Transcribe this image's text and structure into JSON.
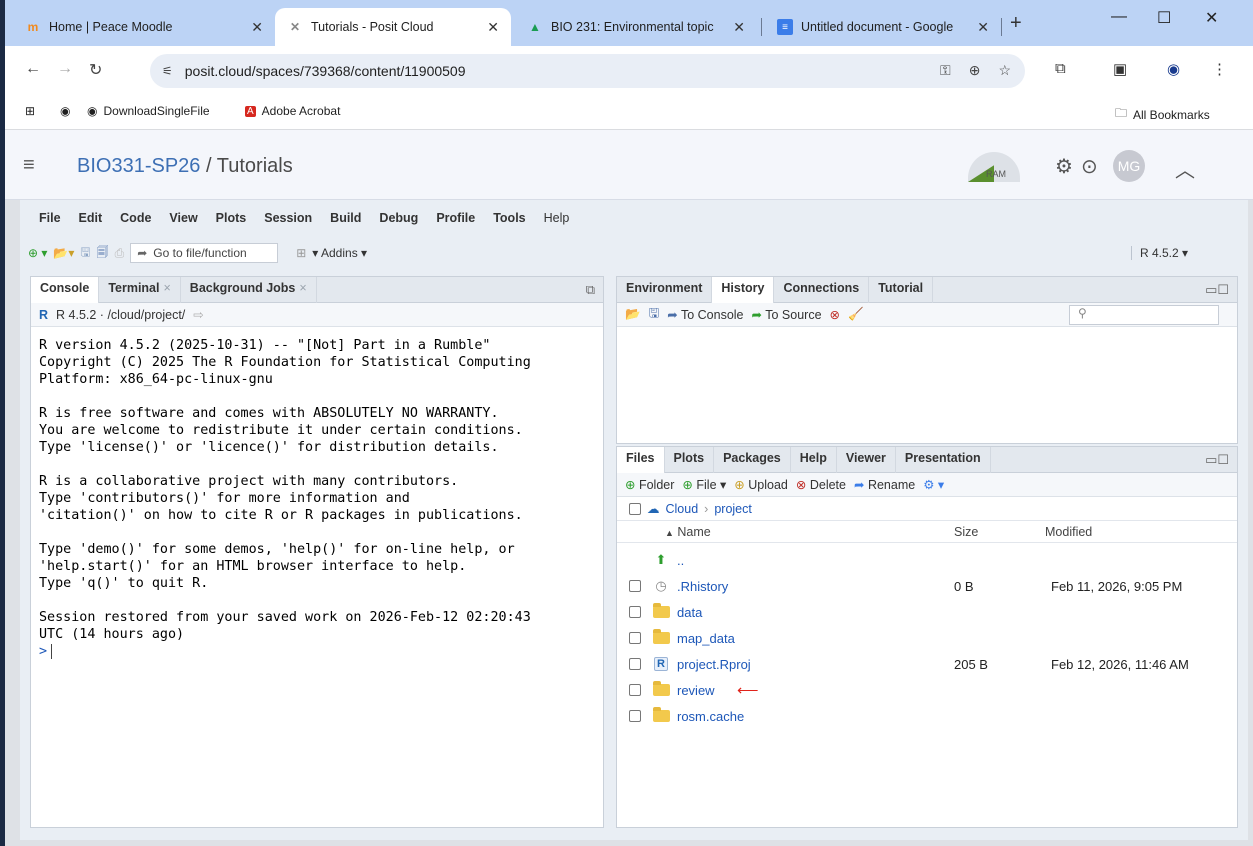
{
  "browser": {
    "tabs": [
      {
        "title": "Home | Peace Moodle",
        "favicon": "moodle-icon"
      },
      {
        "title": "Tutorials - Posit Cloud",
        "favicon": "posit-icon",
        "active": true
      },
      {
        "title": "BIO 231: Environmental topic",
        "favicon": "google-drive-icon"
      },
      {
        "title": "Untitled document - Google",
        "favicon": "google-docs-icon"
      }
    ],
    "url": "posit.cloud/spaces/739368/content/11900509",
    "bookmarks": [
      "DownloadSingleFile",
      "Adobe Acrobat"
    ],
    "all_bookmarks": "All Bookmarks"
  },
  "posit": {
    "space": "BIO331-SP26",
    "separator": "/",
    "project": "Tutorials",
    "ram_label": "RAM",
    "avatar_initials": "MG"
  },
  "rstudio": {
    "menu": [
      "File",
      "Edit",
      "Code",
      "View",
      "Plots",
      "Session",
      "Build",
      "Debug",
      "Profile",
      "Tools",
      "Help"
    ],
    "goto_file": "Go to file/function",
    "addins": "Addins",
    "r_version": "R 4.5.2"
  },
  "console_pane": {
    "tabs": [
      "Console",
      "Terminal",
      "Background Jobs"
    ],
    "path": "R 4.5.2 · /cloud/project/",
    "lines": [
      "R version 4.5.2 (2025-10-31) -- \"[Not] Part in a Rumble\"",
      "Copyright (C) 2025 The R Foundation for Statistical Computing",
      "Platform: x86_64-pc-linux-gnu",
      "",
      "R is free software and comes with ABSOLUTELY NO WARRANTY.",
      "You are welcome to redistribute it under certain conditions.",
      "Type 'license()' or 'licence()' for distribution details.",
      "",
      "R is a collaborative project with many contributors.",
      "Type 'contributors()' for more information and",
      "'citation()' on how to cite R or R packages in publications.",
      "",
      "Type 'demo()' for some demos, 'help()' for on-line help, or",
      "'help.start()' for an HTML browser interface to help.",
      "Type 'q()' to quit R.",
      "",
      "Session restored from your saved work on 2026-Feb-12 02:20:43",
      "UTC (14 hours ago)"
    ],
    "prompt": ">"
  },
  "env_pane": {
    "tabs": [
      "Environment",
      "History",
      "Connections",
      "Tutorial"
    ],
    "to_console": "To Console",
    "to_source": "To Source"
  },
  "files_pane": {
    "tabs": [
      "Files",
      "Plots",
      "Packages",
      "Help",
      "Viewer",
      "Presentation"
    ],
    "toolbar": {
      "folder": "Folder",
      "file": "File",
      "upload": "Upload",
      "delete": "Delete",
      "rename": "Rename"
    },
    "breadcrumb": [
      "Cloud",
      "project"
    ],
    "columns": {
      "name": "Name",
      "size": "Size",
      "modified": "Modified"
    },
    "parent": "..",
    "rows": [
      {
        "name": ".Rhistory",
        "size": "0 B",
        "modified": "Feb 11, 2026, 9:05 PM",
        "icon": "history-file-icon"
      },
      {
        "name": "data",
        "size": "",
        "modified": "",
        "icon": "folder-icon"
      },
      {
        "name": "map_data",
        "size": "",
        "modified": "",
        "icon": "folder-icon"
      },
      {
        "name": "project.Rproj",
        "size": "205 B",
        "modified": "Feb 12, 2026, 11:46 AM",
        "icon": "rproj-icon"
      },
      {
        "name": "review",
        "size": "",
        "modified": "",
        "icon": "folder-icon"
      },
      {
        "name": "rosm.cache",
        "size": "",
        "modified": "",
        "icon": "folder-icon"
      }
    ]
  },
  "colors": {
    "accent": "#3d6fb4",
    "link": "#1d57b8",
    "folder": "#f2c94c",
    "annotation": "#e0231b"
  }
}
